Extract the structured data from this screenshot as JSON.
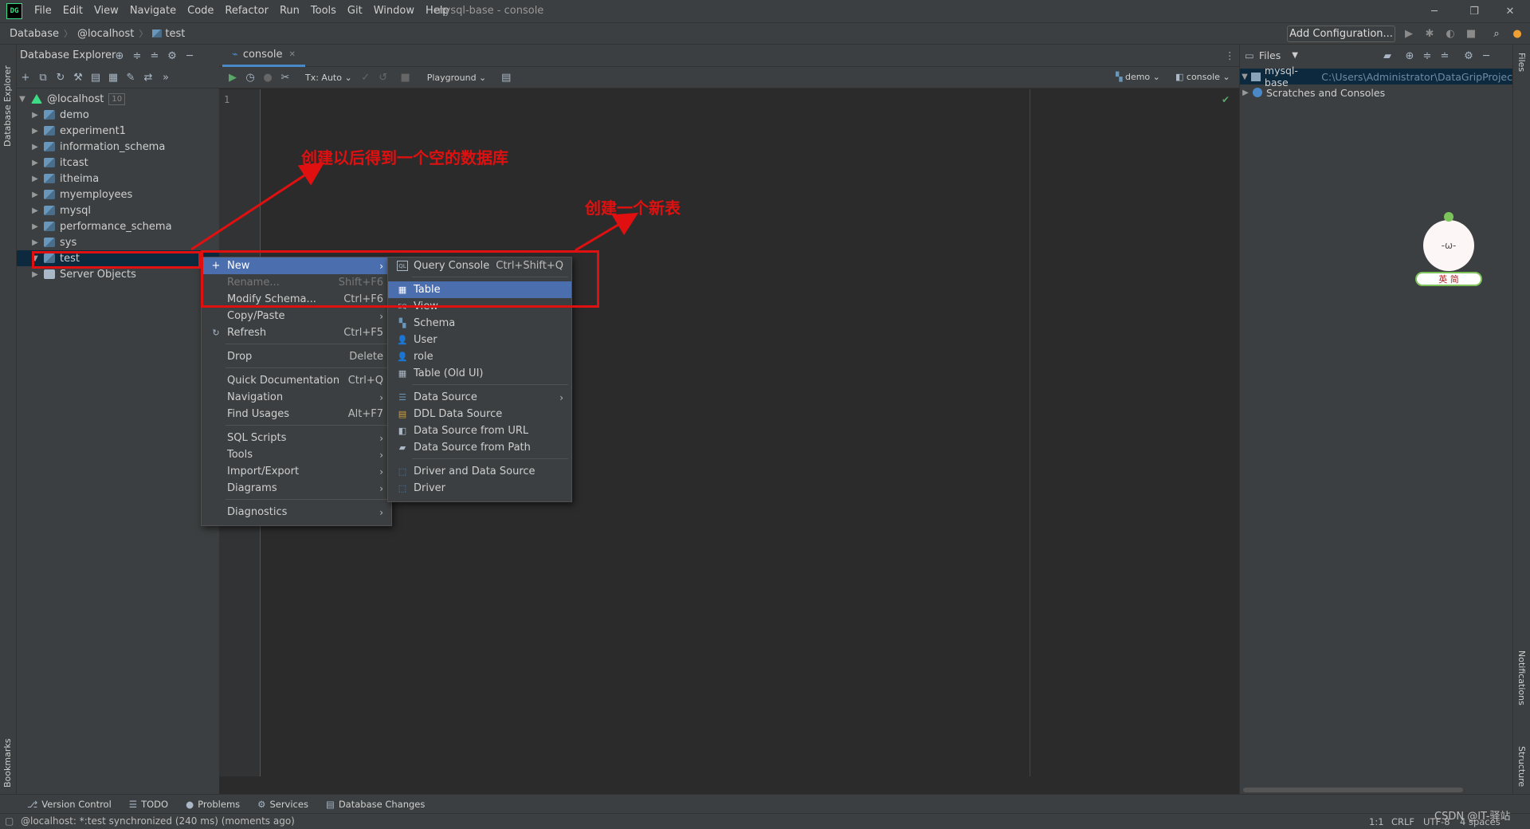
{
  "app": {
    "logo": "DG",
    "window_title": "mysql-base - console",
    "menu": [
      "File",
      "Edit",
      "View",
      "Navigate",
      "Code",
      "Refactor",
      "Run",
      "Tools",
      "Git",
      "Window",
      "Help"
    ]
  },
  "breadcrumb": [
    "Database",
    "@localhost",
    "test"
  ],
  "toolbar": {
    "add_configuration": "Add Configuration..."
  },
  "db_explorer": {
    "title": "Database Explorer",
    "root": {
      "label": "@localhost",
      "count": "10"
    },
    "schemas": [
      "demo",
      "experiment1",
      "information_schema",
      "itcast",
      "itheima",
      "myemployees",
      "mysql",
      "performance_schema",
      "sys",
      "test"
    ],
    "server_objects": "Server Objects",
    "left_strip_label": "Database Explorer",
    "bookmarks_label": "Bookmarks"
  },
  "editor": {
    "tab_label": "console",
    "tx_mode": "Tx: Auto",
    "playground": "Playground",
    "schema_selector": "demo",
    "session_selector": "console",
    "line_number": "1"
  },
  "files_panel": {
    "title": "Files",
    "project_name": "mysql-base",
    "project_path": "C:\\Users\\Administrator\\DataGripProjec",
    "scratches": "Scratches and Consoles",
    "strip_files": "Files",
    "strip_notifications": "Notifications",
    "strip_structure": "Structure"
  },
  "context_menu": {
    "items": [
      {
        "label": "New",
        "shortcut": "",
        "submenu": true,
        "active": true
      },
      {
        "label": "Rename...",
        "shortcut": "Shift+F6",
        "disabled": true
      },
      {
        "label": "Modify Schema...",
        "shortcut": "Ctrl+F6"
      },
      {
        "label": "Copy/Paste",
        "shortcut": "",
        "submenu": true
      },
      {
        "label": "Refresh",
        "shortcut": "Ctrl+F5"
      },
      {
        "label": "Drop",
        "shortcut": "Delete"
      },
      {
        "label": "Quick Documentation",
        "shortcut": "Ctrl+Q"
      },
      {
        "label": "Navigation",
        "shortcut": "",
        "submenu": true
      },
      {
        "label": "Find Usages",
        "shortcut": "Alt+F7"
      },
      {
        "label": "SQL Scripts",
        "shortcut": "",
        "submenu": true
      },
      {
        "label": "Tools",
        "shortcut": "",
        "submenu": true
      },
      {
        "label": "Import/Export",
        "shortcut": "",
        "submenu": true
      },
      {
        "label": "Diagrams",
        "shortcut": "",
        "submenu": true
      },
      {
        "label": "Diagnostics",
        "shortcut": "",
        "submenu": true
      }
    ]
  },
  "new_submenu": {
    "items": [
      {
        "label": "Query Console",
        "shortcut": "Ctrl+Shift+Q",
        "icon": "console-icon"
      },
      {
        "label": "Table",
        "active": true,
        "icon": "table-icon"
      },
      {
        "label": "View",
        "icon": "view-icon"
      },
      {
        "label": "Schema",
        "icon": "schema-icon"
      },
      {
        "label": "User",
        "icon": "user-icon"
      },
      {
        "label": "role",
        "icon": "role-icon"
      },
      {
        "label": "Table (Old UI)",
        "icon": "table-icon"
      },
      {
        "label": "Data Source",
        "submenu": true,
        "icon": "data-source-icon"
      },
      {
        "label": "DDL Data Source",
        "icon": "ddl-icon"
      },
      {
        "label": "Data Source from URL",
        "icon": "url-icon"
      },
      {
        "label": "Data Source from Path",
        "icon": "folder-icon"
      },
      {
        "label": "Driver and Data Source",
        "icon": "driver-icon"
      },
      {
        "label": "Driver",
        "icon": "driver-icon"
      }
    ]
  },
  "annotations": {
    "empty_db_note": "创建以后得到一个空的数据库",
    "new_table_note": "创建一个新表"
  },
  "sticker": {
    "face": "-ω-",
    "ime_label": "英 简"
  },
  "tool_windows": [
    "Version Control",
    "TODO",
    "Problems",
    "Services",
    "Database Changes"
  ],
  "status": {
    "message": "@localhost: *:test synchronized (240 ms) (moments ago)",
    "position": "1:1",
    "line_sep": "CRLF",
    "encoding": "UTF-8",
    "indent": "4 spaces",
    "watermark": "CSDN @IT-驿站"
  },
  "colors": {
    "selection": "#4b6eaf",
    "annotation": "#e01010",
    "background": "#2b2b2b",
    "panel": "#3c3f41"
  }
}
